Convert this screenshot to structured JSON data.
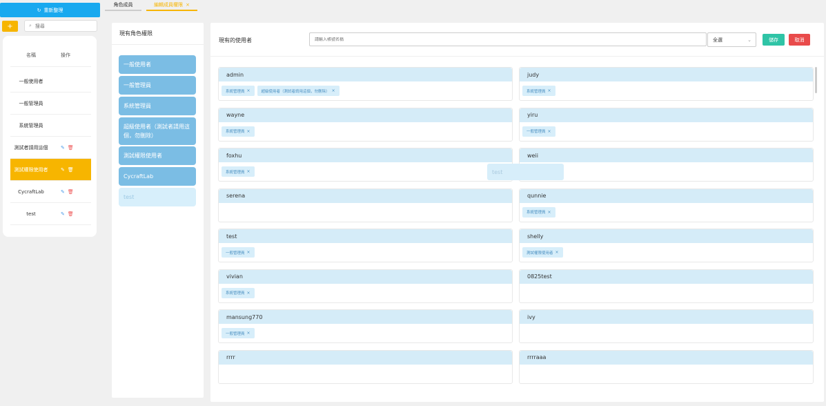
{
  "sidebar": {
    "refresh_label": "重新整理",
    "add_label": "+",
    "search_placeholder": "搜尋",
    "columns": {
      "name": "名稱",
      "actions": "操作"
    },
    "roles": [
      {
        "name": "一般使用者",
        "editable": false,
        "active": false
      },
      {
        "name": "一般管理員",
        "editable": false,
        "active": false
      },
      {
        "name": "系統管理員",
        "editable": false,
        "active": false
      },
      {
        "name": "測試者請用這個",
        "editable": true,
        "active": false
      },
      {
        "name": "測試權限使用者",
        "editable": true,
        "active": true
      },
      {
        "name": "CycraftLab",
        "editable": true,
        "active": false
      },
      {
        "name": "test",
        "editable": true,
        "active": false
      }
    ]
  },
  "tabs": [
    {
      "label": "角色成員",
      "active": false
    },
    {
      "label": "編輯成員權限",
      "active": true,
      "closable": true
    }
  ],
  "permissions_panel": {
    "title": "現有角色權限",
    "items": [
      "一般使用者",
      "一般管理員",
      "系統管理員",
      "超級使用者（測試者請用這個，勿刪除）",
      "測試權限使用者",
      "CycraftLab",
      "test"
    ]
  },
  "users_panel": {
    "title": "現有的使用者",
    "search_placeholder": "請輸入帳號名稱",
    "filter_value": "全選",
    "save_label": "儲存",
    "cancel_label": "取消",
    "drag_ghost": "test",
    "users": [
      {
        "name": "admin",
        "tags": [
          "系統管理員",
          "超級使用者（測試者請用這個，勿刪除）"
        ]
      },
      {
        "name": "judy",
        "tags": [
          "系統管理員"
        ]
      },
      {
        "name": "wayne",
        "tags": [
          "系統管理員"
        ]
      },
      {
        "name": "yiru",
        "tags": [
          "一般管理員"
        ]
      },
      {
        "name": "foxhu",
        "tags": [
          "系統管理員"
        ]
      },
      {
        "name": "weii",
        "tags": []
      },
      {
        "name": "serena",
        "tags": []
      },
      {
        "name": "qunnie",
        "tags": [
          "系統管理員"
        ]
      },
      {
        "name": "test",
        "tags": [
          "一般管理員"
        ]
      },
      {
        "name": "shelly",
        "tags": [
          "測試權限使用者"
        ]
      },
      {
        "name": "vivian",
        "tags": [
          "系統管理員"
        ]
      },
      {
        "name": "0825test",
        "tags": []
      },
      {
        "name": "mansung770",
        "tags": [
          "一般管理員"
        ]
      },
      {
        "name": "ivy",
        "tags": []
      },
      {
        "name": "rrrr",
        "tags": []
      },
      {
        "name": "rrrraaa",
        "tags": []
      }
    ]
  },
  "colors": {
    "primary_blue": "#19a9ef",
    "accent_yellow": "#f7b500",
    "save_green": "#2fc4a6",
    "cancel_red": "#e94b4b",
    "perm_blue": "#7bbde4"
  }
}
